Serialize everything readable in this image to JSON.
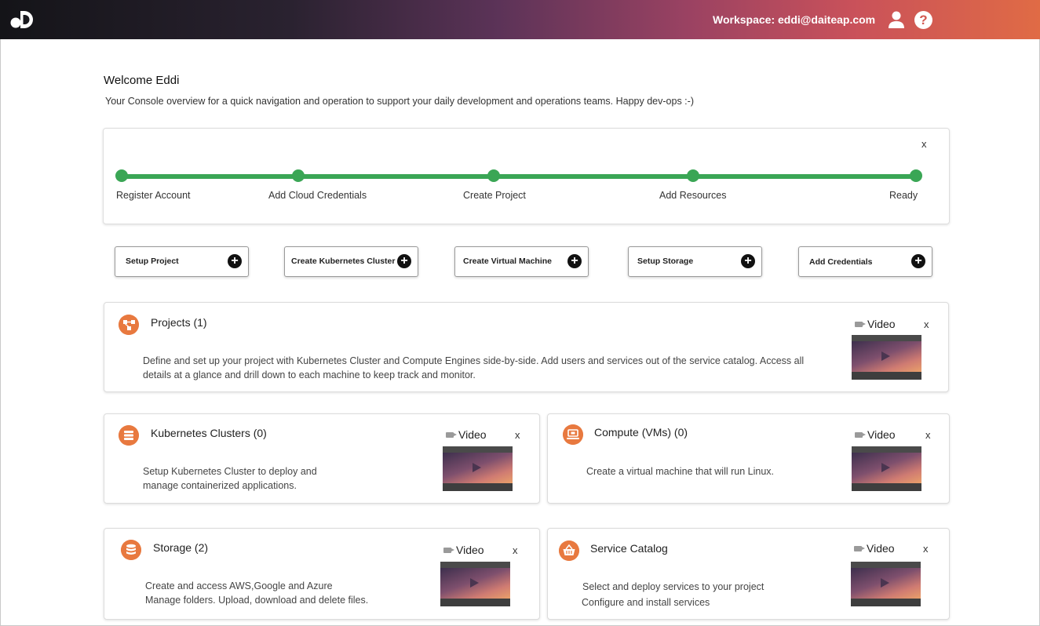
{
  "header": {
    "workspace_label": "Workspace: eddi@daiteap.com",
    "gradient_colors": [
      "#141418",
      "#5c3358",
      "#c9515a",
      "#e06b45"
    ],
    "icons": [
      "daiteap-logo-icon",
      "user-icon",
      "help-icon"
    ]
  },
  "welcome": {
    "title": "Welcome Eddi",
    "subtitle": "Your Console overview for a quick navigation and operation to support your daily development and operations teams. Happy dev-ops :-)"
  },
  "progress": {
    "close_label": "x",
    "accent_color": "#3aa655",
    "steps": [
      {
        "label": "Register Account"
      },
      {
        "label": "Add Cloud Credentials"
      },
      {
        "label": "Create Project"
      },
      {
        "label": "Add Resources"
      },
      {
        "label": "Ready"
      }
    ]
  },
  "actions": [
    {
      "label": "Setup Project",
      "icon": "plus-circle-icon"
    },
    {
      "label": "Create Kubernetes Cluster",
      "icon": "plus-circle-icon"
    },
    {
      "label": "Create Virtual Machine",
      "icon": "plus-circle-icon"
    },
    {
      "label": "Setup Storage",
      "icon": "plus-circle-icon"
    },
    {
      "label": "Add Credentials",
      "icon": "plus-circle-icon"
    }
  ],
  "cards": {
    "video_label": "Video",
    "close_label": "x",
    "icon_color": "#e8793f",
    "projects": {
      "title": "Projects (1)",
      "icon": "project-tree-icon",
      "description": "Define and set up your project with Kubernetes Cluster and Compute Engines side-by-side. Add users and services out of the service catalog. Access all details at a glance and drill down to each machine to keep track and monitor."
    },
    "kubernetes": {
      "title": "Kubernetes Clusters (0)",
      "icon": "cluster-stack-icon",
      "description": "Setup Kubernetes Cluster to deploy and manage containerized applications."
    },
    "compute": {
      "title": "Compute (VMs) (0)",
      "icon": "laptop-icon",
      "description": "Create a virtual machine that will run Linux."
    },
    "storage": {
      "title": "Storage (2)",
      "icon": "database-icon",
      "description_line1": "Create and access AWS,Google and Azure",
      "description_line2": "Manage folders. Upload, download and delete files."
    },
    "catalog": {
      "title": "Service Catalog",
      "icon": "basket-icon",
      "description_line1": "Select and deploy services to your project",
      "description_line2": "Configure and install services"
    }
  }
}
